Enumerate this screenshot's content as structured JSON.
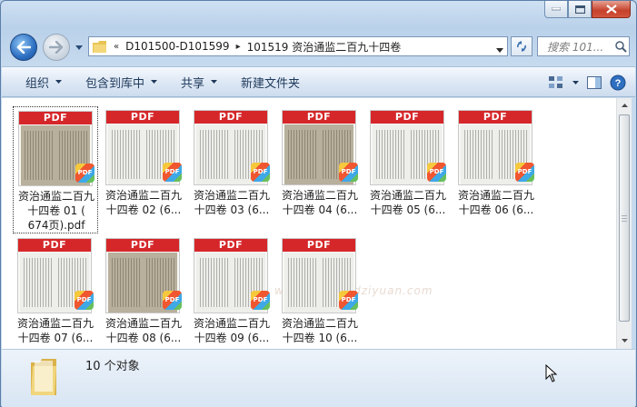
{
  "nav": {
    "crumb_overflow": "«",
    "breadcrumbs": [
      "D101500-D101599",
      "101519 资治通监二百九十四卷"
    ],
    "search_placeholder": "搜索 101..."
  },
  "toolbar": {
    "organize": "组织",
    "include_in_library": "包含到库中",
    "share": "共享",
    "new_folder": "新建文件夹"
  },
  "files": [
    {
      "name_line1": "资治通监二百九",
      "name_line2": "十四卷 01 (",
      "name_line3": "674页).pdf",
      "thumb": "dark",
      "selected": true
    },
    {
      "name_line1": "资治通监二百九",
      "name_line2": "十四卷 02 (6...",
      "thumb": "light"
    },
    {
      "name_line1": "资治通监二百九",
      "name_line2": "十四卷 03 (6...",
      "thumb": "light"
    },
    {
      "name_line1": "资治通监二百九",
      "name_line2": "十四卷 04 (6...",
      "thumb": "dark"
    },
    {
      "name_line1": "资治通监二百九",
      "name_line2": "十四卷 05 (6...",
      "thumb": "light"
    },
    {
      "name_line1": "资治通监二百九",
      "name_line2": "十四卷 06 (6...",
      "thumb": "light"
    },
    {
      "name_line1": "资治通监二百九",
      "name_line2": "十四卷 07 (6...",
      "thumb": "light"
    },
    {
      "name_line1": "资治通监二百九",
      "name_line2": "十四卷 08 (6...",
      "thumb": "dark"
    },
    {
      "name_line1": "资治通监二百九",
      "name_line2": "十四卷 09 (6...",
      "thumb": "light"
    },
    {
      "name_line1": "资治通监二百九",
      "name_line2": "十四卷 10 (6...",
      "thumb": "light"
    }
  ],
  "pdf_label": "PDF",
  "status": {
    "item_count": "10 个对象"
  },
  "watermark": "www.guoxuedziyuan.com",
  "colors": {
    "pdf_band": "#d5272a",
    "accent": "#2d6fc2"
  }
}
